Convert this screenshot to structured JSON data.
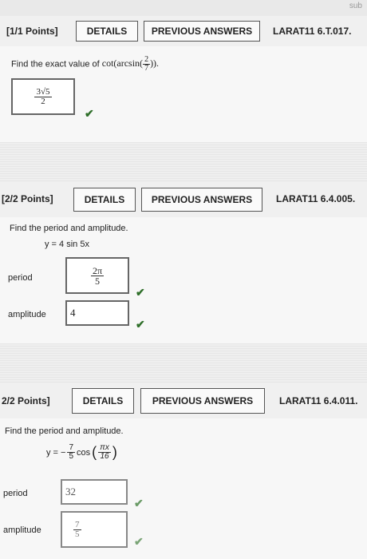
{
  "topbar": {
    "fragment": "sub"
  },
  "q1": {
    "points": "[1/1 Points]",
    "details": "DETAILS",
    "previous": "PREVIOUS ANSWERS",
    "code": "LARAT11 6.T.017.",
    "prompt": "Find the exact value of",
    "func": "cot(arcsin(",
    "fnum": "2",
    "fden": "7",
    "close": ")).",
    "ans_num": "3√5",
    "ans_den": "2"
  },
  "q2": {
    "points": "[2/2 Points]",
    "details": "DETAILS",
    "previous": "PREVIOUS ANSWERS",
    "code": "LARAT11 6.4.005.",
    "prompt": "Find the period and amplitude.",
    "equation": "y = 4 sin 5x",
    "period_label": "period",
    "period_num": "2π",
    "period_den": "5",
    "amplitude_label": "amplitude",
    "amplitude_value": "4"
  },
  "q3": {
    "points": "2/2 Points]",
    "details": "DETAILS",
    "previous": "PREVIOUS ANSWERS",
    "code": "LARAT11 6.4.011.",
    "prompt": "Find the period and amplitude.",
    "eq_left": "y = −",
    "coef_num": "7",
    "coef_den": "5",
    "eq_func": "cos",
    "arg_num": "πx",
    "arg_den": "16",
    "period_label": "period",
    "period_value": "32",
    "amplitude_label": "amplitude",
    "amp_num": "7",
    "amp_den": "5"
  },
  "icons": {
    "check": "checkmark-icon"
  }
}
